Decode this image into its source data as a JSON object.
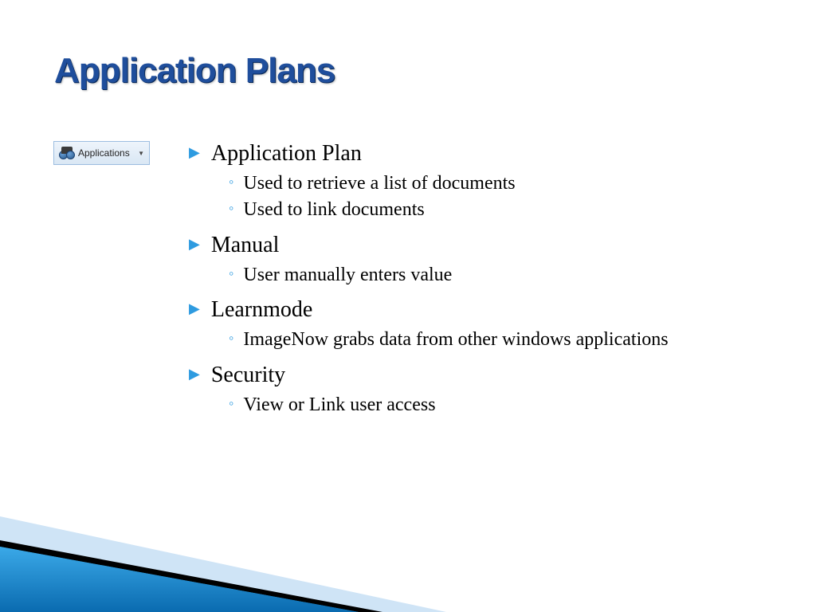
{
  "title": "Application Plans",
  "app_button": {
    "label": "Applications"
  },
  "bullets": [
    {
      "label": "Application Plan",
      "subs": [
        "Used to retrieve a list of documents",
        "Used to link documents"
      ]
    },
    {
      "label": "Manual",
      "subs": [
        "User manually enters value"
      ]
    },
    {
      "label": "Learnmode",
      "subs": [
        "ImageNow grabs data from other windows applications"
      ]
    },
    {
      "label": "Security",
      "subs": [
        "View or Link user access"
      ]
    }
  ]
}
